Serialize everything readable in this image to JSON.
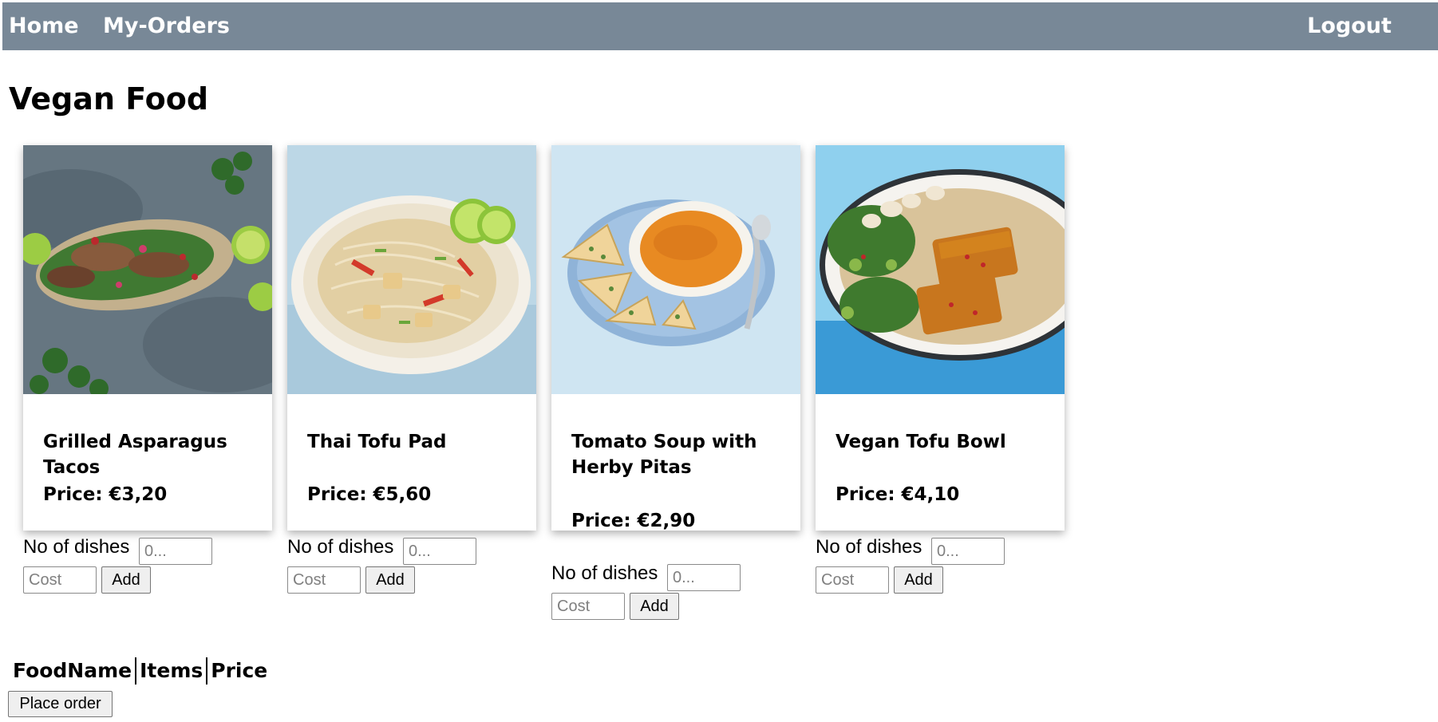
{
  "nav": {
    "home_label": "Home",
    "orders_label": "My-Orders",
    "logout_label": "Logout"
  },
  "page_title": "Vegan Food",
  "dishes": [
    {
      "name": "Grilled Asparagus Tacos",
      "price": "Price: €3,20"
    },
    {
      "name": "Thai Tofu Pad",
      "price": "Price: €5,60"
    },
    {
      "name": "Tomato Soup with Herby Pitas",
      "price": "Price: €2,90"
    },
    {
      "name": "Vegan Tofu Bowl",
      "price": "Price: €4,10"
    }
  ],
  "order_form": {
    "dishes_label": "No of dishes",
    "dishes_placeholder": "0...",
    "cost_placeholder": "Cost",
    "add_label": "Add"
  },
  "orders_table": {
    "headers": [
      "FoodName",
      "Items",
      "Price"
    ]
  },
  "place_order_label": "Place order",
  "colors": {
    "navbar": "#788897",
    "nav_text": "#ffffff"
  }
}
